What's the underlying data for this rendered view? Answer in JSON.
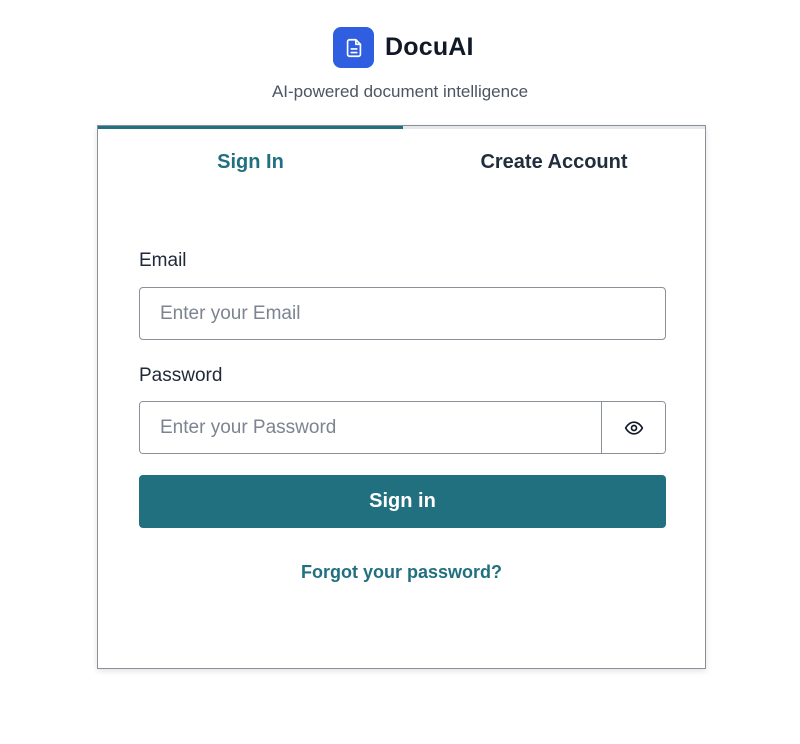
{
  "brand": {
    "name": "DocuAI",
    "tagline": "AI-powered document intelligence",
    "logo_icon": "document-icon",
    "logo_color": "#2f5fe0"
  },
  "auth": {
    "tabs": [
      {
        "label": "Sign In",
        "active": true
      },
      {
        "label": "Create Account",
        "active": false
      }
    ],
    "email": {
      "label": "Email",
      "placeholder": "Enter your Email",
      "value": ""
    },
    "password": {
      "label": "Password",
      "placeholder": "Enter your Password",
      "value": "",
      "toggle_icon": "eye-icon"
    },
    "submit_label": "Sign in",
    "forgot_label": "Forgot your password?"
  },
  "colors": {
    "accent": "#21707f",
    "brand": "#2f5fe0"
  }
}
